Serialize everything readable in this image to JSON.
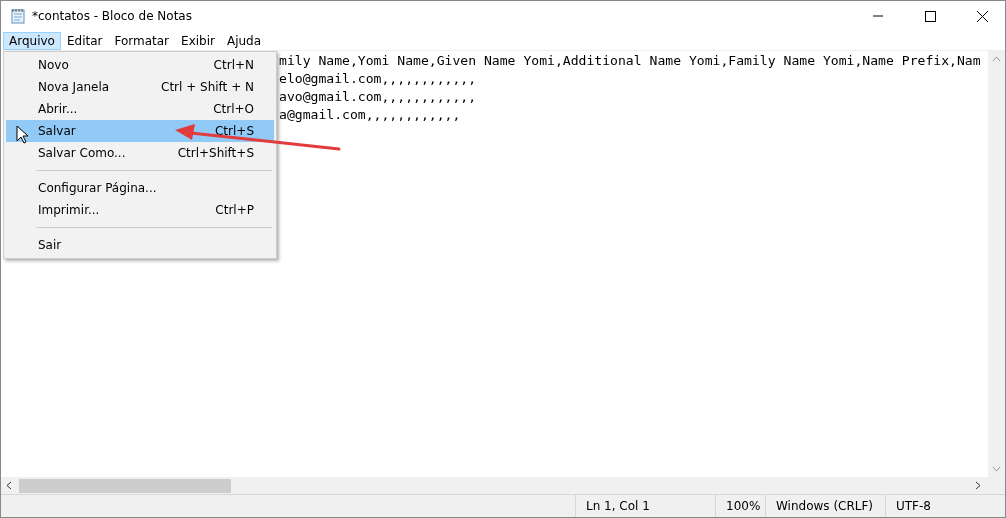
{
  "window": {
    "title": "*contatos - Bloco de Notas"
  },
  "menubar": [
    {
      "label": "Arquivo",
      "selected": true
    },
    {
      "label": "Editar",
      "selected": false
    },
    {
      "label": "Formatar",
      "selected": false
    },
    {
      "label": "Exibir",
      "selected": false
    },
    {
      "label": "Ajuda",
      "selected": false
    }
  ],
  "editor": {
    "lines": [
      "mily Name,Yomi Name,Given Name Yomi,Additional Name Yomi,Family Name Yomi,Name Prefix,Nam",
      "elo@gmail.com,,,,,,,,,,,,",
      "avo@gmail.com,,,,,,,,,,,,",
      "a@gmail.com,,,,,,,,,,,,"
    ]
  },
  "menu": [
    {
      "kind": "item",
      "label": "Novo",
      "shortcut": "Ctrl+N",
      "selected": false
    },
    {
      "kind": "item",
      "label": "Nova Janela",
      "shortcut": "Ctrl + Shift + N",
      "selected": false
    },
    {
      "kind": "item",
      "label": "Abrir...",
      "shortcut": "Ctrl+O",
      "selected": false
    },
    {
      "kind": "item",
      "label": "Salvar",
      "shortcut": "Ctrl+S",
      "selected": true
    },
    {
      "kind": "item",
      "label": "Salvar Como...",
      "shortcut": "Ctrl+Shift+S",
      "selected": false
    },
    {
      "kind": "separator"
    },
    {
      "kind": "item",
      "label": "Configurar Página...",
      "selected": false
    },
    {
      "kind": "item",
      "label": "Imprimir...",
      "shortcut": "Ctrl+P",
      "selected": false
    },
    {
      "kind": "separator"
    },
    {
      "kind": "item",
      "label": "Sair",
      "selected": false
    }
  ],
  "status_bar": [
    "Ln 1, Col 1",
    "100%",
    "Windows (CRLF)",
    "UTF-8"
  ]
}
